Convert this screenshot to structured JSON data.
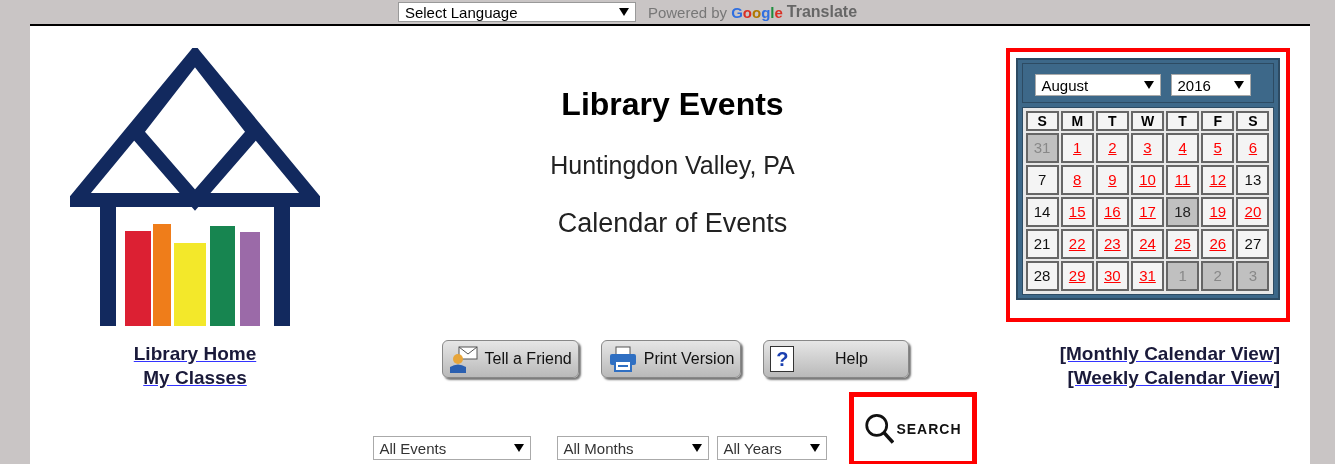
{
  "translate_bar": {
    "language_select": "Select Language",
    "powered_by": "Powered by",
    "brand": "Google",
    "product": "Translate"
  },
  "links_left": [
    "Library Home",
    "My Classes"
  ],
  "header": {
    "title": "Library Events",
    "location": "Huntingdon Valley, PA",
    "subtitle": "Calendar of Events"
  },
  "calendar": {
    "month": "August",
    "year": "2016",
    "weekdays": [
      "S",
      "M",
      "T",
      "W",
      "T",
      "F",
      "S"
    ],
    "days": [
      {
        "label": "31",
        "kind": "other"
      },
      {
        "label": "1",
        "kind": "event"
      },
      {
        "label": "2",
        "kind": "event"
      },
      {
        "label": "3",
        "kind": "event"
      },
      {
        "label": "4",
        "kind": "event"
      },
      {
        "label": "5",
        "kind": "event"
      },
      {
        "label": "6",
        "kind": "event"
      },
      {
        "label": "7",
        "kind": "plain"
      },
      {
        "label": "8",
        "kind": "event"
      },
      {
        "label": "9",
        "kind": "event"
      },
      {
        "label": "10",
        "kind": "event"
      },
      {
        "label": "11",
        "kind": "event"
      },
      {
        "label": "12",
        "kind": "event"
      },
      {
        "label": "13",
        "kind": "plain"
      },
      {
        "label": "14",
        "kind": "plain"
      },
      {
        "label": "15",
        "kind": "event"
      },
      {
        "label": "16",
        "kind": "event"
      },
      {
        "label": "17",
        "kind": "event"
      },
      {
        "label": "18",
        "kind": "today"
      },
      {
        "label": "19",
        "kind": "event"
      },
      {
        "label": "20",
        "kind": "event"
      },
      {
        "label": "21",
        "kind": "plain"
      },
      {
        "label": "22",
        "kind": "event"
      },
      {
        "label": "23",
        "kind": "event"
      },
      {
        "label": "24",
        "kind": "event"
      },
      {
        "label": "25",
        "kind": "event"
      },
      {
        "label": "26",
        "kind": "event"
      },
      {
        "label": "27",
        "kind": "plain"
      },
      {
        "label": "28",
        "kind": "plain"
      },
      {
        "label": "29",
        "kind": "event"
      },
      {
        "label": "30",
        "kind": "event"
      },
      {
        "label": "31",
        "kind": "event"
      },
      {
        "label": "1",
        "kind": "other"
      },
      {
        "label": "2",
        "kind": "other"
      },
      {
        "label": "3",
        "kind": "other"
      }
    ]
  },
  "calendar_links": [
    "[Monthly Calendar View]",
    "[Weekly Calendar View]"
  ],
  "buttons": [
    {
      "label": "Tell a Friend",
      "kind": "email"
    },
    {
      "label": "Print Version",
      "kind": "print"
    },
    {
      "label": "Help",
      "kind": "help",
      "icon_text": "?"
    }
  ],
  "filters": [
    {
      "value": "All Events"
    },
    {
      "value": "All Months"
    },
    {
      "value": "All Years"
    }
  ],
  "search": {
    "label": "SEARCH"
  }
}
